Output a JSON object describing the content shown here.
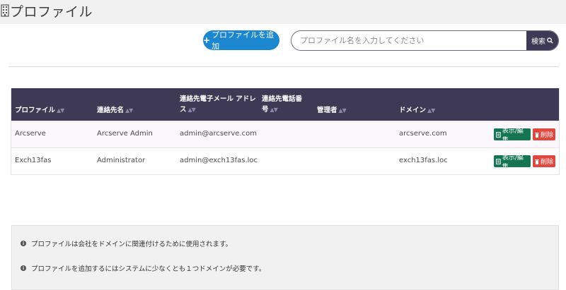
{
  "header": {
    "title": "プロファイル",
    "icon": "building-icon"
  },
  "toolbar": {
    "add_label": "プロファイルを追加"
  },
  "search": {
    "placeholder": "プロファイル名を入力してください",
    "button_label": "検索"
  },
  "table": {
    "columns": [
      "プロファイル",
      "連絡先名",
      "連絡先電子メール アドレス",
      "連絡先電話番号",
      "管理者",
      "ドメイン"
    ],
    "column_lines": {
      "email": [
        "連絡先電子メール アドレ",
        "ス"
      ],
      "phone": [
        "連絡先電話番",
        "号"
      ]
    },
    "rows": [
      {
        "profile": "Arcserve",
        "contact": "Arcserve Admin",
        "email": "admin@arcserve.com",
        "phone": "",
        "admin": "",
        "domain": "arcserve.com"
      },
      {
        "profile": "Exch13fas",
        "contact": "Administrator",
        "email": "admin@exch13fas.loc",
        "phone": "",
        "admin": "",
        "domain": "exch13fas.loc"
      }
    ],
    "edit_label": "表示/編集",
    "delete_label": "削除"
  },
  "info": {
    "lines": [
      "プロファイルは会社をドメインに関連付けるために使用されます。",
      "プロファイルを追加するにはシステムに少なくとも１つドメインが必要です。"
    ]
  },
  "colors": {
    "header_bg": "#3e3955",
    "add_button": "#1c86cf",
    "edit_button": "#157553",
    "delete_button": "#e0473e"
  }
}
